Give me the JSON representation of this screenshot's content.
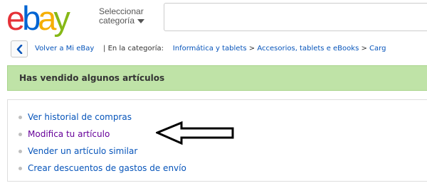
{
  "header": {
    "logo_letters": [
      "e",
      "b",
      "a",
      "y"
    ],
    "category_select": {
      "line1": "Seleccionar",
      "line2": "categoría"
    },
    "search": {
      "value": "",
      "placeholder": ""
    }
  },
  "breadcrumb": {
    "back_label": "Volver a Mi eBay",
    "in_category_label": "| En la categoría:",
    "items": [
      "Informática y tablets",
      "Accesorios, tablets e eBooks",
      "Carg"
    ],
    "separator": ">"
  },
  "banner": {
    "title": "Has vendido algunos artículos"
  },
  "actions": [
    {
      "label": "Ver historial de compras",
      "visited": false
    },
    {
      "label": "Modifica tu artículo",
      "visited": true
    },
    {
      "label": "Vender un artículo similar",
      "visited": false
    },
    {
      "label": "Crear descuentos de gastos de envío",
      "visited": false
    }
  ],
  "colors": {
    "ebay_e": "#e53238",
    "ebay_b": "#0064d2",
    "ebay_a": "#f5af02",
    "ebay_y": "#86b817",
    "link": "#0654ba",
    "visited_link": "#660099",
    "banner_bg": "#bfe3a7"
  },
  "icons": {
    "back": "chevron-left-icon",
    "dropdown": "caret-down-icon",
    "annotation": "left-arrow-annotation"
  }
}
